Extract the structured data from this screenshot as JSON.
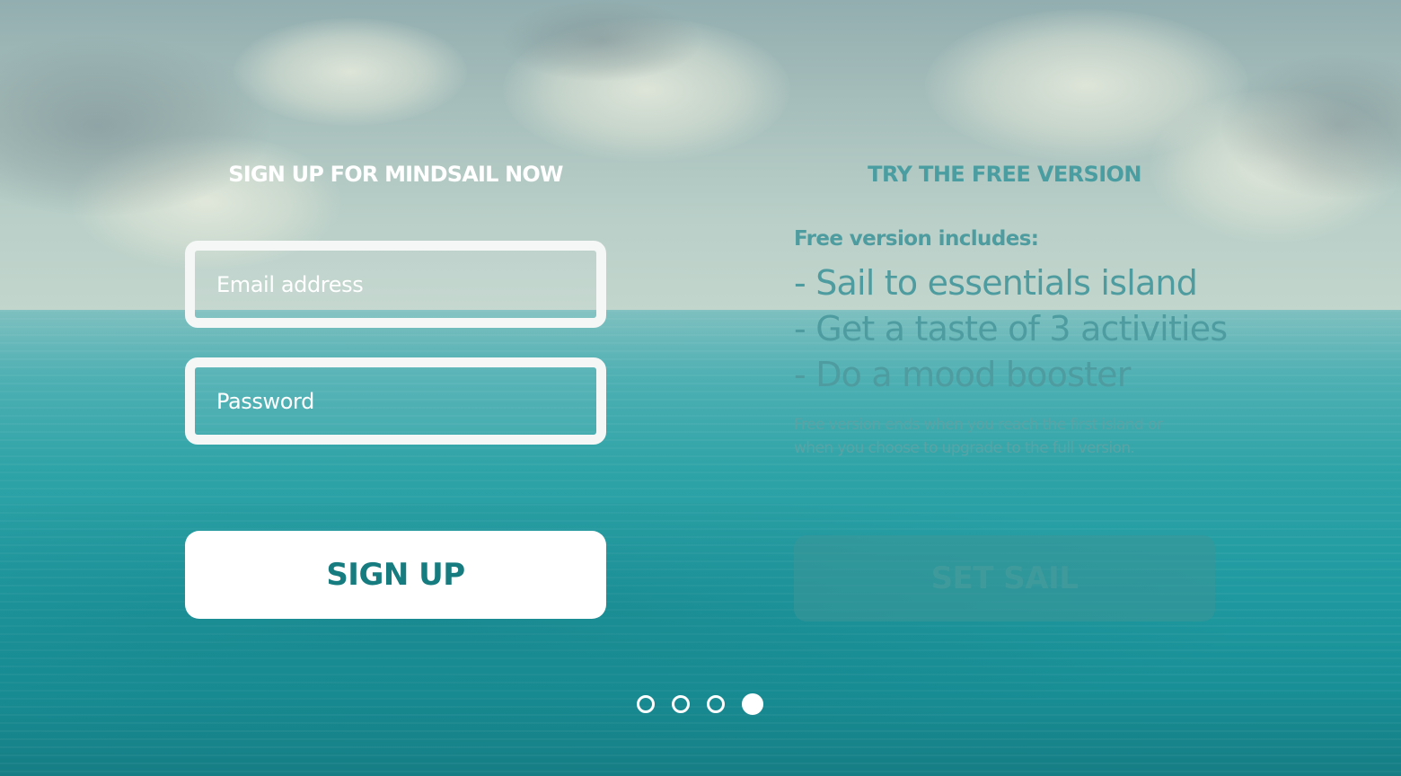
{
  "signup": {
    "title": "SIGN UP FOR MINDSAIL NOW",
    "email_placeholder": "Email address",
    "password_placeholder": "Password",
    "button_label": "SIGN UP",
    "button_text_color": "#177c7f"
  },
  "free_version": {
    "title": "TRY THE FREE VERSION",
    "includes_heading": "Free version includes:",
    "features": [
      "- Sail to essentials island",
      "- Get a taste of 3 activities",
      "- Do a mood booster"
    ],
    "footnote_line1": "Free version ends when you reach the first island or",
    "footnote_line2": "when you choose to upgrade to the full version.",
    "button_label": "SET SAIL"
  },
  "pager": {
    "total_pages": 4,
    "current_page": 4
  },
  "colors": {
    "accent": "#177c7f",
    "muted_text": "#4e9c9f",
    "white": "#ffffff"
  }
}
